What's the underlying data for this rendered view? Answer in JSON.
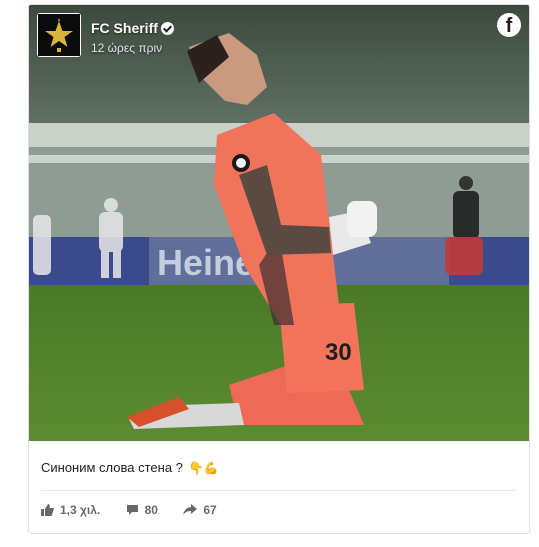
{
  "post": {
    "page_name": "FC Sheriff",
    "time": "12 ώρες πριν",
    "caption": "Синоним слова стена ?",
    "caption_emoji": "👇💪"
  },
  "photo": {
    "stadium_board_text": "Heineken",
    "jersey_number": "30"
  },
  "stats": {
    "likes": "1,3 χιλ.",
    "comments": "80",
    "shares": "67"
  },
  "icons": {
    "logo": "sheriff-logo",
    "platform": "facebook-icon",
    "verified": "verified-check-icon",
    "like": "thumbs-up-icon",
    "comment": "comment-icon",
    "share": "share-arrow-icon"
  },
  "colors": {
    "pitch": "#4f7f2a",
    "jersey": "#f0735c",
    "logo_gold": "#d8b43a"
  }
}
